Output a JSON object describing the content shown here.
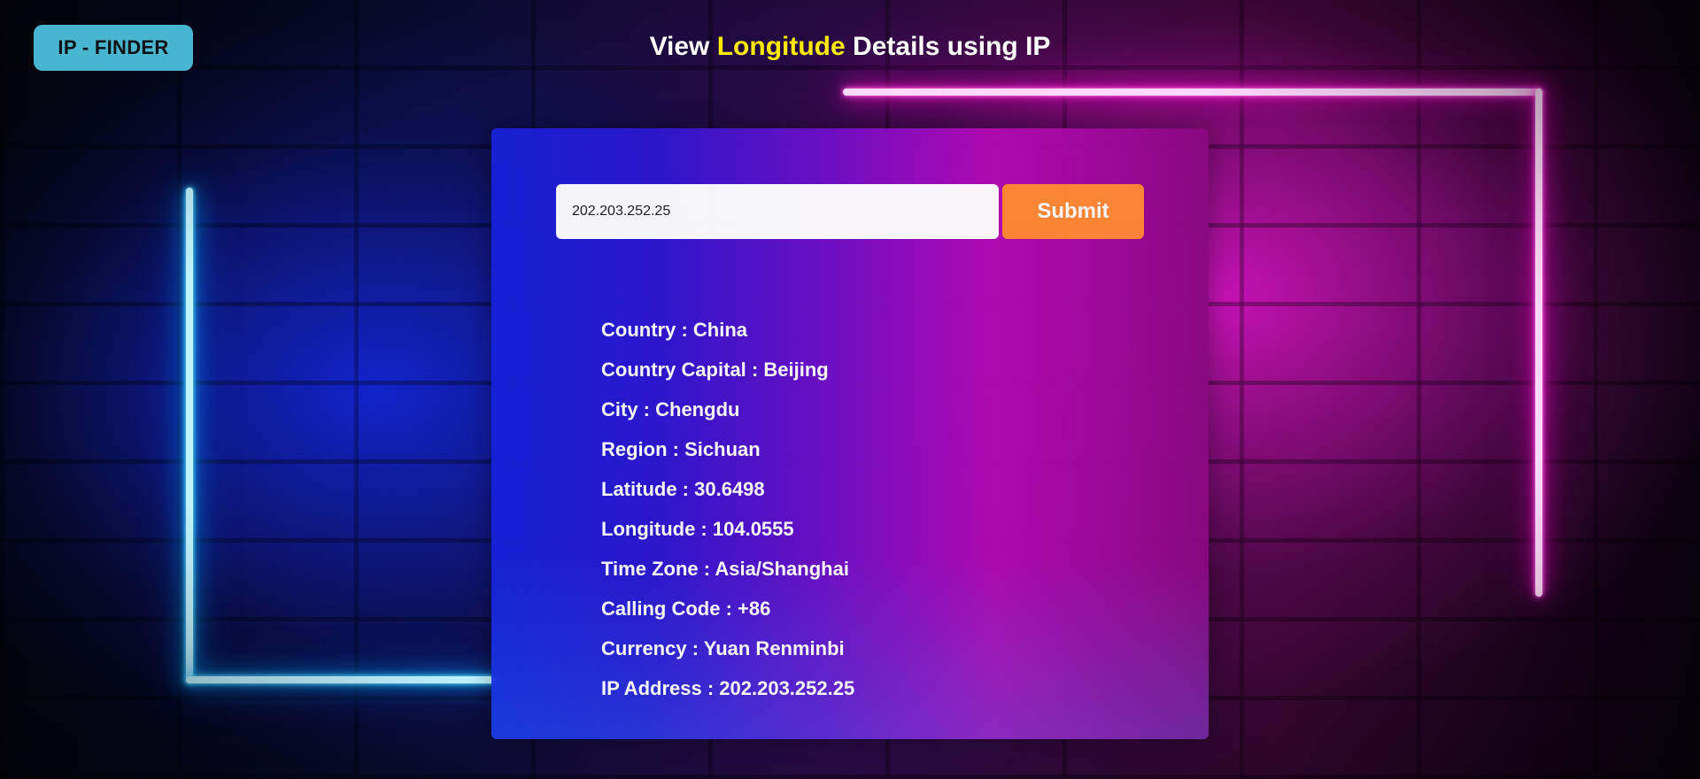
{
  "header": {
    "logo_label": "IP - FINDER",
    "title_prefix": "View ",
    "title_highlight": "Longitude",
    "title_suffix": " Details using IP"
  },
  "search": {
    "value": "202.203.252.25",
    "submit_label": "Submit"
  },
  "details": [
    {
      "label": "Country",
      "value": "China"
    },
    {
      "label": "Country Capital",
      "value": "Beijing"
    },
    {
      "label": "City",
      "value": "Chengdu"
    },
    {
      "label": "Region",
      "value": "Sichuan"
    },
    {
      "label": "Latitude",
      "value": "30.6498"
    },
    {
      "label": "Longitude",
      "value": "104.0555"
    },
    {
      "label": "Time Zone",
      "value": "Asia/Shanghai"
    },
    {
      "label": "Calling Code",
      "value": "+86"
    },
    {
      "label": "Currency",
      "value": "Yuan Renminbi"
    },
    {
      "label": "IP Address",
      "value": "202.203.252.25"
    }
  ],
  "colors": {
    "logo_bg": "#48b6cf",
    "title_highlight": "#ffea00",
    "submit_bg": "#ff8a33",
    "neon_blue": "#28c7ff",
    "neon_pink": "#ff2bd8"
  }
}
